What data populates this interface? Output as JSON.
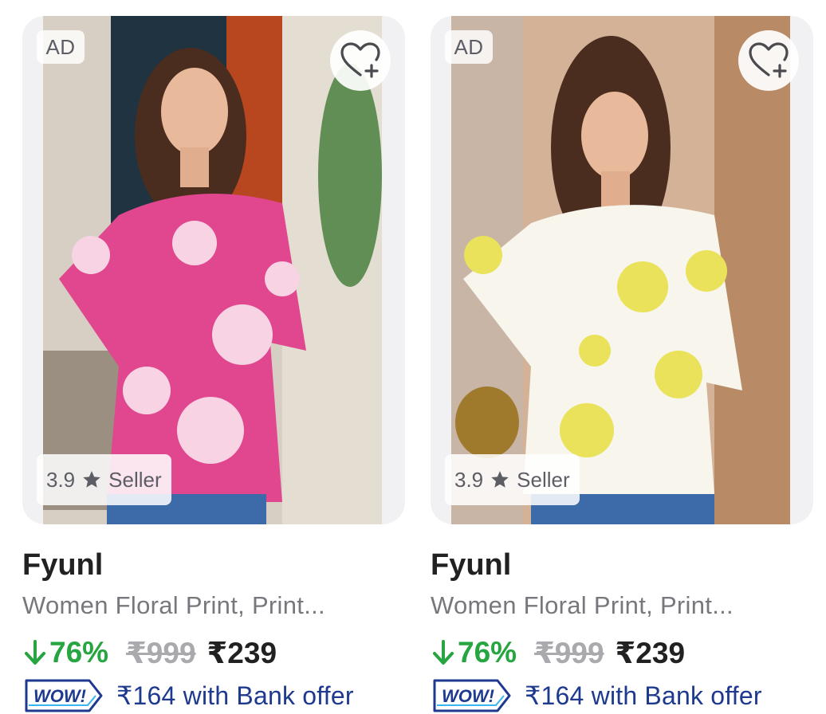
{
  "products": [
    {
      "ad_label": "AD",
      "wishlist_icon": "heart-plus-icon",
      "rating": "3.9",
      "rating_star_icon": "star-icon",
      "rating_suffix": "Seller",
      "brand": "Fyunl",
      "title": "Women Floral Print, Print...",
      "discount": "76%",
      "mrp": "₹999",
      "price": "₹239",
      "offer_badge": "WOW!",
      "offer_text": "₹164 with Bank offer",
      "kurti_color": "#e0478f",
      "flower_color": "#f7d3e3"
    },
    {
      "ad_label": "AD",
      "wishlist_icon": "heart-plus-icon",
      "rating": "3.9",
      "rating_star_icon": "star-icon",
      "rating_suffix": "Seller",
      "brand": "Fyunl",
      "title": "Women Floral Print, Print...",
      "discount": "76%",
      "mrp": "₹999",
      "price": "₹239",
      "offer_badge": "WOW!",
      "offer_text": "₹164 with Bank offer",
      "kurti_color": "#f7f5ec",
      "flower_color": "#e9e25a"
    }
  ],
  "colors": {
    "discount_green": "#26a541",
    "offer_blue": "#1d3a8f",
    "muted_text": "#77787d"
  }
}
